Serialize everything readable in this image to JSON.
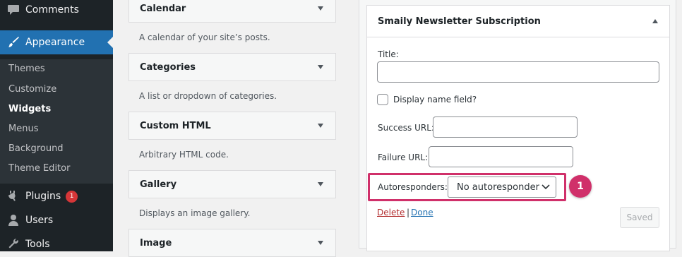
{
  "sidebar": {
    "menu": {
      "comments": {
        "label": "Comments",
        "icon": "comments-icon"
      },
      "appearance": {
        "label": "Appearance",
        "icon": "paintbrush-icon"
      },
      "plugins": {
        "label": "Plugins",
        "icon": "plugins-icon",
        "badge": "1"
      },
      "users": {
        "label": "Users",
        "icon": "users-icon"
      },
      "tools": {
        "label": "Tools",
        "icon": "wrench-icon"
      }
    },
    "submenu": {
      "themes": "Themes",
      "customize": "Customize",
      "widgets": "Widgets",
      "menus": "Menus",
      "background": "Background",
      "theme_editor": "Theme Editor"
    }
  },
  "available_widgets": {
    "calendar": {
      "title": "Calendar",
      "desc": "A calendar of your site’s posts."
    },
    "categories": {
      "title": "Categories",
      "desc": "A list or dropdown of categories."
    },
    "custom_html": {
      "title": "Custom HTML",
      "desc": "Arbitrary HTML code."
    },
    "gallery": {
      "title": "Gallery",
      "desc": "Displays an image gallery."
    },
    "image": {
      "title": "Image"
    }
  },
  "widget_form": {
    "title": "Smaily Newsletter Subscription",
    "title_label": "Title:",
    "title_value": "",
    "display_name_label": "Display name field?",
    "success_url_label": "Success URL:",
    "success_url_value": "",
    "failure_url_label": "Failure URL:",
    "failure_url_value": "",
    "autoresponders_label": "Autoresponders:",
    "autoresponders_selected": "No autoresponder",
    "delete_label": "Delete",
    "separator": "|",
    "done_label": "Done",
    "saved_label": "Saved"
  },
  "annotation": {
    "callout_number": "1",
    "highlight_color": "#d0306a"
  },
  "colors": {
    "sidebar_bg": "#1d2327",
    "submenu_bg": "#2c3338",
    "accent": "#2271b1",
    "delete": "#b32d2e",
    "badge": "#d63638"
  }
}
